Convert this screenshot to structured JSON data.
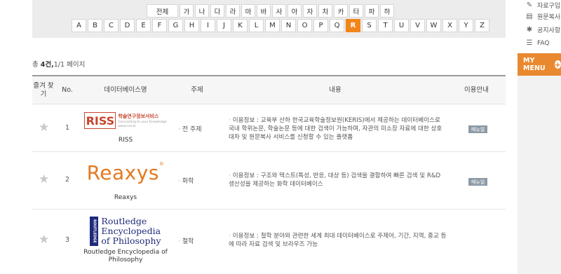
{
  "filters": {
    "korean": [
      "전체",
      "가",
      "나",
      "다",
      "라",
      "마",
      "바",
      "사",
      "아",
      "자",
      "차",
      "카",
      "타",
      "파",
      "하"
    ],
    "english": [
      "A",
      "B",
      "C",
      "D",
      "E",
      "F",
      "G",
      "H",
      "I",
      "J",
      "K",
      "L",
      "M",
      "N",
      "O",
      "P",
      "Q",
      "R",
      "S",
      "T",
      "U",
      "V",
      "W",
      "X",
      "Y",
      "Z"
    ],
    "active": "R"
  },
  "sidebar": {
    "items": [
      {
        "icon": "pencil-icon",
        "label": "자료구입"
      },
      {
        "icon": "document-icon",
        "label": "원문복사"
      },
      {
        "icon": "pin-icon",
        "label": "공지사항"
      },
      {
        "icon": "faq-icon",
        "label": "FAQ"
      }
    ],
    "my_menu": "MY MENU",
    "my_menu_plus": "+"
  },
  "count": {
    "prefix": "총",
    "total": "4",
    "unit": "건,",
    "page": "1/1",
    "page_suffix": "페이지"
  },
  "table": {
    "headers": {
      "fav": "즐겨 찾기",
      "no": "No.",
      "db": "데이터베이스명",
      "subject": "주제",
      "desc": "내용",
      "use": "이용안내"
    },
    "rows": [
      {
        "no": "1",
        "name": "RISS",
        "logo": {
          "mark": "RISS",
          "line1": "학술연구정보서비스",
          "line2": "Connecting to your Knowledge",
          "line3": "www.riss.kr"
        },
        "subject": "전 주제",
        "desc": "이용정보 : 교육부 산하 한국교육학술정보원(KERIS)에서 제공하는 데이터베이스로 국내 학위논문, 학술논문 등에 대한 검색이 가능하며, 자관의 미소장 자료에 대한 상호대차 및 원문복사 서비스를 신청할 수 있는 플랫폼",
        "manual": "매뉴얼"
      },
      {
        "no": "2",
        "name": "Reaxys",
        "logo": {
          "text": "Reaxys",
          "mark": "®"
        },
        "subject": "화학",
        "desc": "이용정보 : 구조와 텍스트(특성, 반응, 대상 등) 검색을 결합하여 빠른 검색 및 R&D 생산성을 제공하는 화학 데이터베이스",
        "manual": "매뉴얼"
      },
      {
        "no": "3",
        "name": "Routledge Encyclopedia of Philosophy",
        "logo": {
          "bar": "ROUTLEDGE",
          "l1": "Routledge",
          "l2": "Encyclopedia",
          "l3": "of Philosophy"
        },
        "subject": "철학",
        "desc": "이용정보 : 철학 분야와 관련한 세계 최대 데이터베이스로 주제어, 기간, 지역, 종교 등에 따라 자료 검색 및 브라우즈 가능",
        "manual": ""
      }
    ]
  },
  "colors": {
    "accent": "#f0861a",
    "mymenu": "#e9892f",
    "manual_badge": "#8c9aa6",
    "riss": "#c6462d",
    "reaxys": "#e5791f",
    "routledge": "#1f2a7a"
  }
}
